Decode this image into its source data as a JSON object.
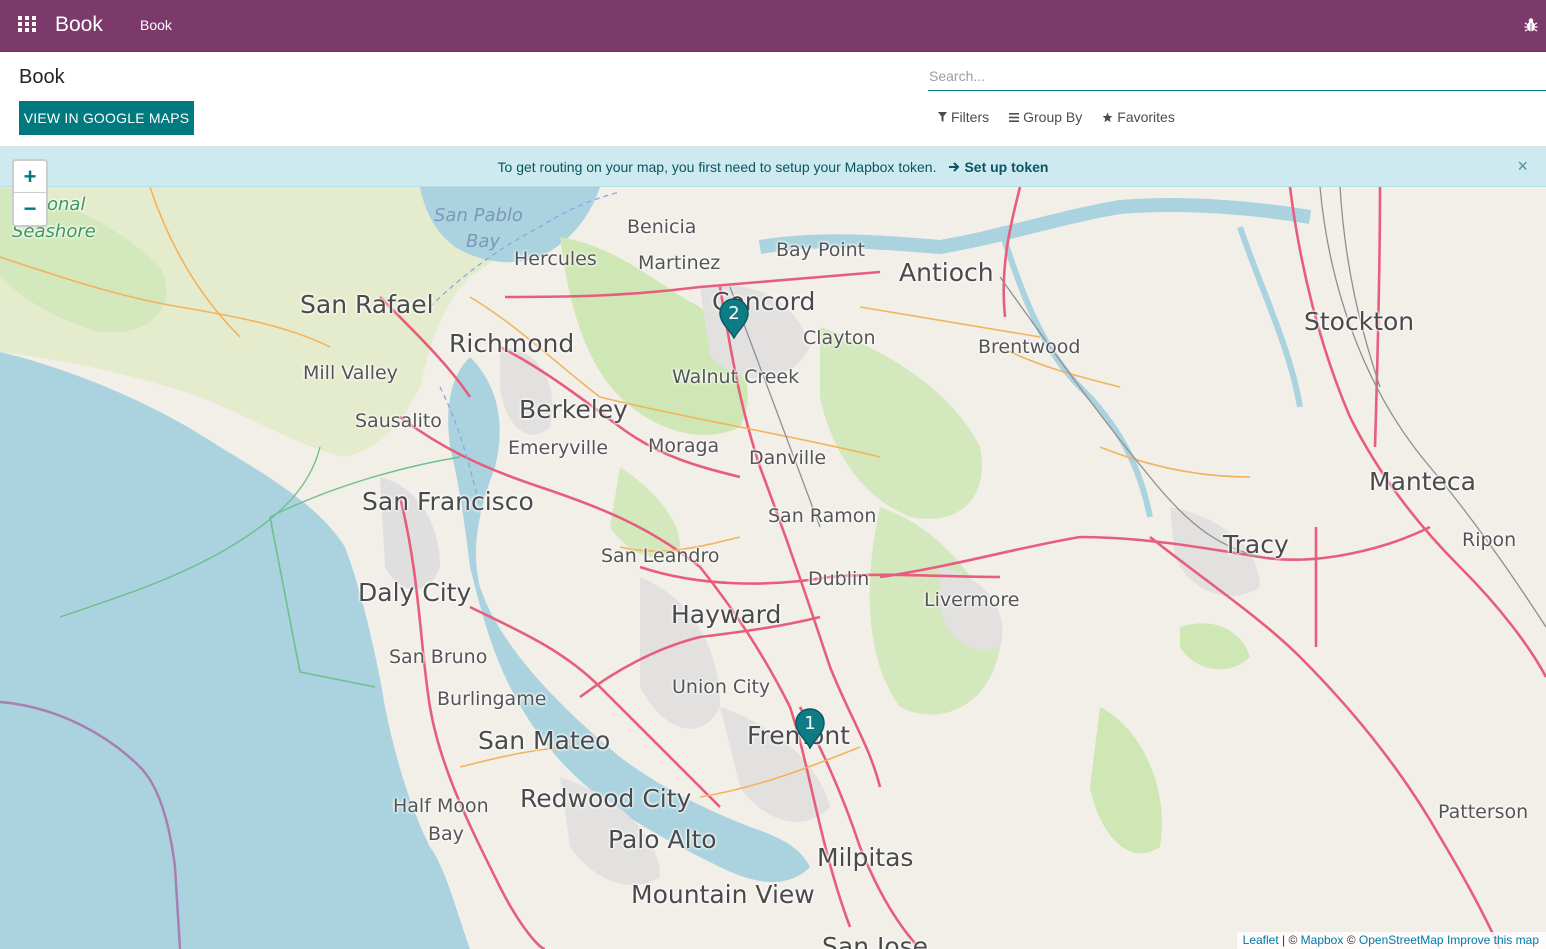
{
  "navbar": {
    "brand": "Book",
    "menu_item": "Book",
    "color": "#7c3a6b"
  },
  "control_panel": {
    "title": "Book",
    "google_maps_button": "VIEW IN GOOGLE MAPS",
    "search_placeholder": "Search...",
    "filters_label": "Filters",
    "group_by_label": "Group By",
    "favorites_label": "Favorites"
  },
  "map": {
    "alert_message": "To get routing on your map, you first need to setup your Mapbox token.",
    "setup_token_label": "Set up token",
    "close_symbol": "×",
    "zoom_in": "+",
    "zoom_out": "−",
    "markers": [
      {
        "number": "1",
        "near": "Fremont"
      },
      {
        "number": "2",
        "near": "Concord"
      }
    ],
    "marker_color": "#0f7c85",
    "places": {
      "benicia": "Benicia",
      "bay_point": "Bay Point",
      "antioch": "Antioch",
      "hercules": "Hercules",
      "martinez": "Martinez",
      "concord": "Concord",
      "stockton": "Stockton",
      "san_rafael": "San Rafael",
      "richmond": "Richmond",
      "clayton": "Clayton",
      "brentwood": "Brentwood",
      "mill_valley": "Mill Valley",
      "walnut_creek": "Walnut Creek",
      "berkeley": "Berkeley",
      "sausalito": "Sausalito",
      "emeryville": "Emeryville",
      "moraga": "Moraga",
      "danville": "Danville",
      "manteca": "Manteca",
      "san_francisco": "San Francisco",
      "san_ramon": "San Ramon",
      "tracy": "Tracy",
      "ripon": "Ripon",
      "san_leandro": "San Leandro",
      "dublin": "Dublin",
      "daly_city": "Daly City",
      "livermore": "Livermore",
      "hayward": "Hayward",
      "san_bruno": "San Bruno",
      "union_city": "Union City",
      "burlingame": "Burlingame",
      "fremont": "Fremont",
      "san_mateo": "San Mateo",
      "half_moon": "Half Moon",
      "bay": "Bay",
      "redwood_city": "Redwood City",
      "patterson": "Patterson",
      "palo_alto": "Palo Alto",
      "milpitas": "Milpitas",
      "mountain_view": "Mountain View",
      "san_jose": "San Jose",
      "san_pablo": "San Pablo",
      "san_pablo_bay": "Bay",
      "national": "ional",
      "seashore": "Seashore"
    },
    "attribution": {
      "leaflet": "Leaflet",
      "separator": "| ©",
      "mapbox": "Mapbox",
      "copy": "©",
      "osm": "OpenStreetMap",
      "improve": "Improve this map"
    }
  }
}
